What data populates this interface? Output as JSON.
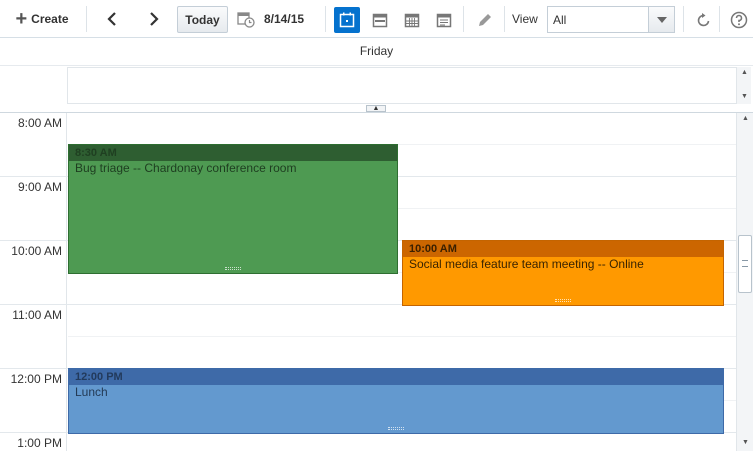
{
  "toolbar": {
    "create_label": "Create",
    "today_label": "Today",
    "date": "8/14/15",
    "view_label": "View",
    "view_select": "All"
  },
  "day_header": {
    "day_name": "Friday"
  },
  "time_labels": [
    "8:00 AM",
    "9:00 AM",
    "10:00 AM",
    "11:00 AM",
    "12:00 PM",
    "1:00 PM"
  ],
  "events": [
    {
      "time": "8:30 AM",
      "title": "Bug triage -- Chardonay conference room",
      "color": "#4e9a52",
      "header_color": "#2e5e31"
    },
    {
      "time": "10:00 AM",
      "title": "Social media feature team meeting -- Online",
      "color": "#ff9900",
      "header_color": "#cc6600"
    },
    {
      "time": "12:00 PM",
      "title": "Lunch",
      "color": "#6399cf",
      "header_color": "#3e6aa8"
    }
  ],
  "colors": {
    "accent": "#0572ce"
  }
}
